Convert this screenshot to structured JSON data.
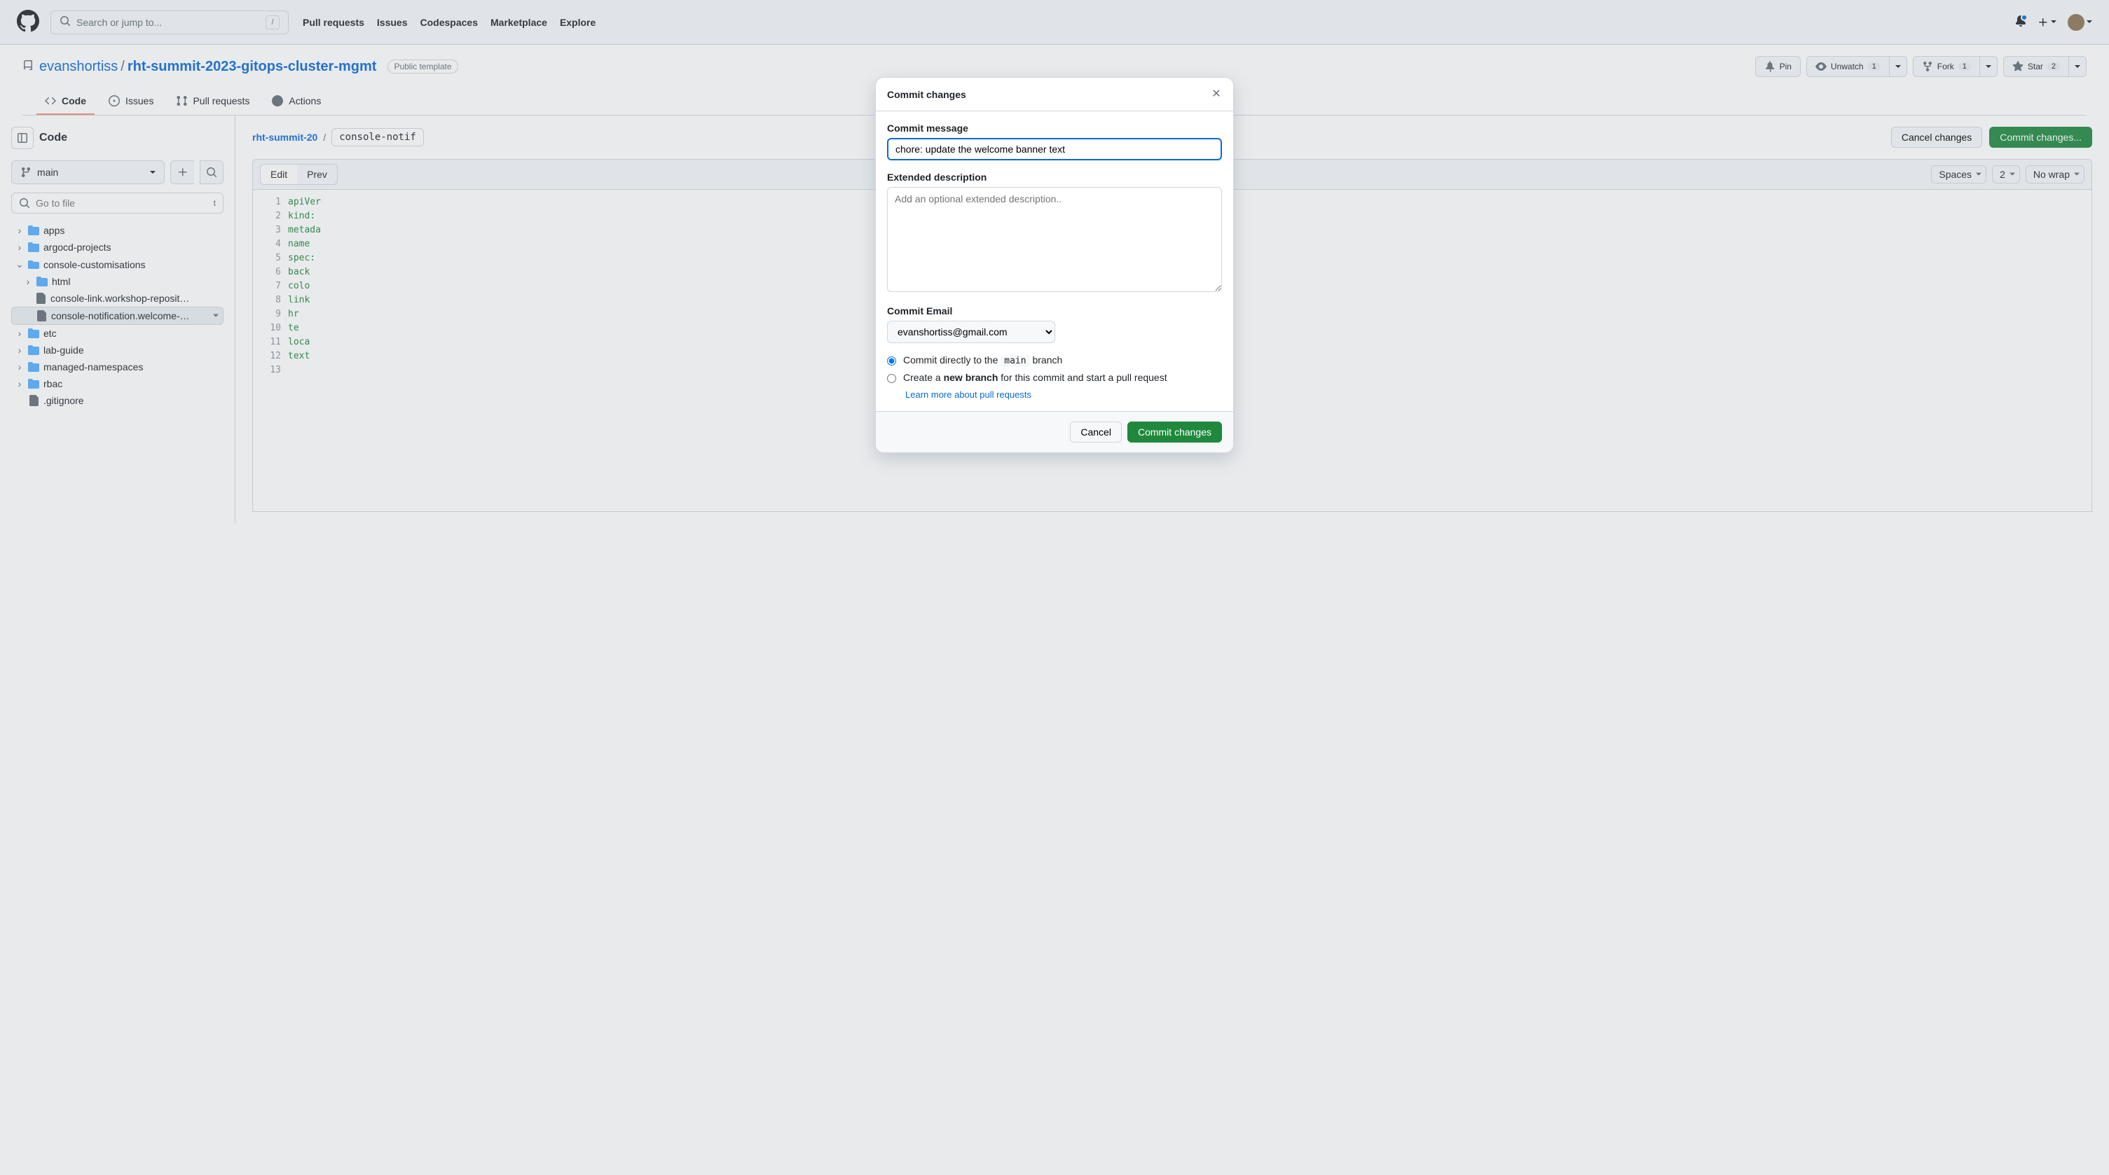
{
  "nav": {
    "search_placeholder": "Search or jump to...",
    "links": [
      "Pull requests",
      "Issues",
      "Codespaces",
      "Marketplace",
      "Explore"
    ]
  },
  "repo": {
    "owner": "evanshortiss",
    "name": "rht-summit-2023-gitops-cluster-mgmt",
    "badge": "Public template",
    "pin": "Pin",
    "unwatch": "Unwatch",
    "unwatch_count": "1",
    "fork": "Fork",
    "fork_count": "1",
    "star": "Star",
    "star_count": "2"
  },
  "tabs": {
    "code": "Code",
    "issues": "Issues",
    "pulls": "Pull requests",
    "actions": "Actions"
  },
  "sidebar": {
    "title": "Code",
    "branch": "main",
    "filter_placeholder": "Go to file",
    "key": "t",
    "tree": {
      "apps": "apps",
      "argocd": "argocd-projects",
      "console": "console-customisations",
      "html": "html",
      "link": "console-link.workshop-reposit…",
      "notif": "console-notification.welcome-…",
      "etc": "etc",
      "lab": "lab-guide",
      "managed": "managed-namespaces",
      "rbac": "rbac",
      "gitignore": ".gitignore"
    }
  },
  "content": {
    "bc_root": "rht-summit-20",
    "bc_file": "console-notif",
    "cancel": "Cancel changes",
    "commit": "Commit changes...",
    "edit": "Edit",
    "preview": "Prev",
    "spaces": "Spaces",
    "indent": "2",
    "wrap": "No wrap",
    "lines": [
      "1",
      "2",
      "3",
      "4",
      "5",
      "6",
      "7",
      "8",
      "9",
      "10",
      "11",
      "12",
      "13"
    ],
    "code": [
      "apiVer",
      "kind:",
      "metada",
      "  name",
      "spec:",
      "  back",
      "  colo",
      "  link",
      "    hr",
      "    te",
      "  loca",
      "  text",
      ""
    ]
  },
  "modal": {
    "title": "Commit changes",
    "msg_label": "Commit message",
    "msg_value": "chore: update the welcome banner text",
    "desc_label": "Extended description",
    "desc_placeholder": "Add an optional extended description..",
    "email_label": "Commit Email",
    "email_value": "evanshortiss@gmail.com",
    "radio_direct_pre": "Commit directly to the ",
    "radio_direct_branch": "main",
    "radio_direct_post": " branch",
    "radio_new_pre": "Create a ",
    "radio_new_bold": "new branch",
    "radio_new_post": " for this commit and start a pull request",
    "learn": "Learn more about pull requests",
    "cancel": "Cancel",
    "commit": "Commit changes"
  }
}
